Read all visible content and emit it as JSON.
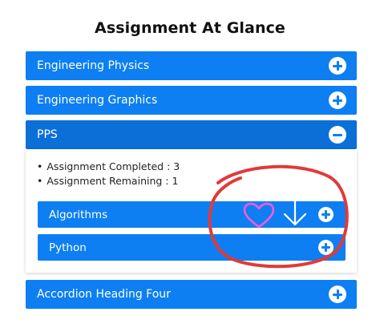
{
  "title": "Assignment At Glance",
  "accordion": {
    "items": [
      {
        "label": "Engineering Physics",
        "icon": "plus-circle-icon"
      },
      {
        "label": "Engineering Graphics",
        "icon": "plus-circle-icon"
      },
      {
        "label": "PPS",
        "icon": "minus-circle-icon"
      },
      {
        "label": "Accordion Heading Four",
        "icon": "plus-circle-icon"
      }
    ],
    "pps": {
      "bullets": [
        "Assignment Completed : 3",
        "Assignment Remaining : 1"
      ],
      "sub_items": [
        {
          "label": "Algorithms",
          "icon": "plus-circle-icon"
        },
        {
          "label": "Python",
          "icon": "plus-circle-icon"
        }
      ]
    }
  },
  "colors": {
    "accent": "#0d7ff2",
    "annotation": "#e03a3a",
    "heart": "#ff5ad8"
  }
}
